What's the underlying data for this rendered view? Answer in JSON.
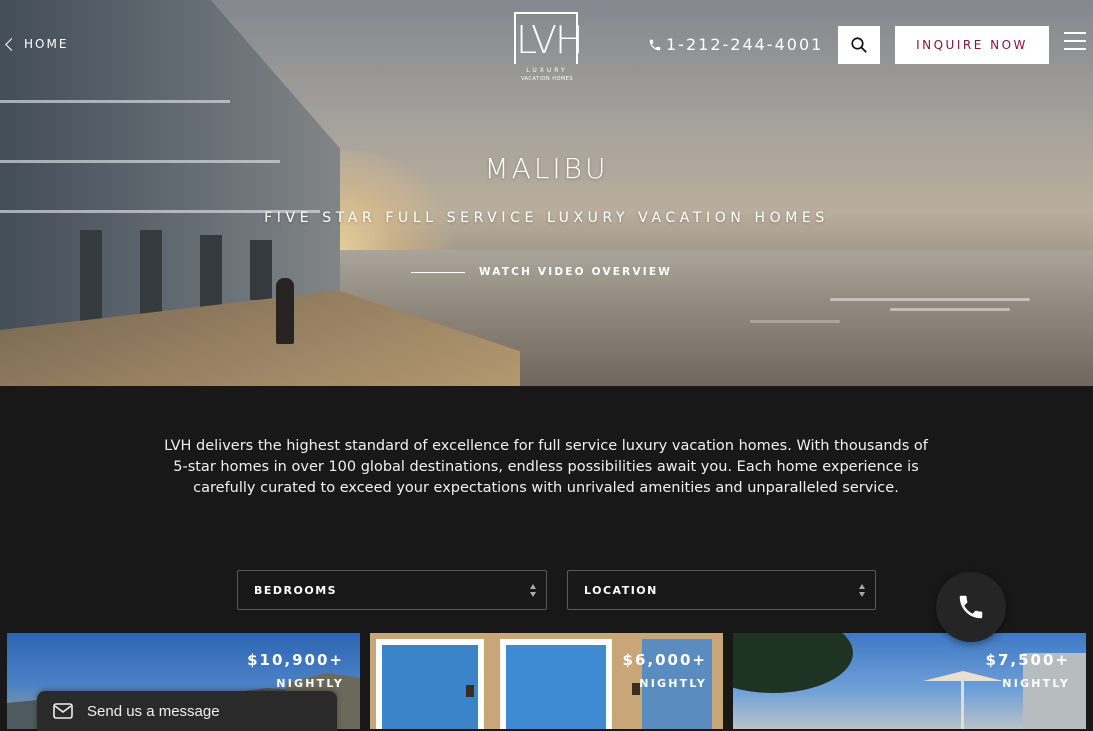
{
  "nav": {
    "home_label": "HOME",
    "logo_mark": "LVH",
    "logo_line1": "LUXURY",
    "logo_line2": "VACATION HOMES",
    "phone": "1-212-244-4001",
    "inquire_label": "INQUIRE NOW",
    "icons": [
      "chevron-left-icon",
      "phone-icon",
      "search-icon",
      "menu-icon"
    ]
  },
  "hero": {
    "title": "MALIBU",
    "subtitle": "FIVE STAR FULL SERVICE LUXURY VACATION HOMES",
    "video_link": "WATCH VIDEO OVERVIEW"
  },
  "intro": {
    "text": "LVH delivers the highest standard of excellence for full service luxury vacation homes. With thousands of 5-star homes in over 100 global destinations, endless possibilities await you. Each home experience is carefully curated to exceed your expectations with unrivaled amenities and unparalleled service."
  },
  "filters": {
    "bedrooms": "BEDROOMS",
    "location": "LOCATION"
  },
  "listings": [
    {
      "price": "$10,900+",
      "unit": "NIGHTLY"
    },
    {
      "price": "$6,000+",
      "unit": "NIGHTLY"
    },
    {
      "price": "$7,500+",
      "unit": "NIGHTLY"
    }
  ],
  "chat": {
    "label": "Send us a message"
  },
  "colors": {
    "accent": "#8a1436",
    "page_bg": "#181818"
  }
}
